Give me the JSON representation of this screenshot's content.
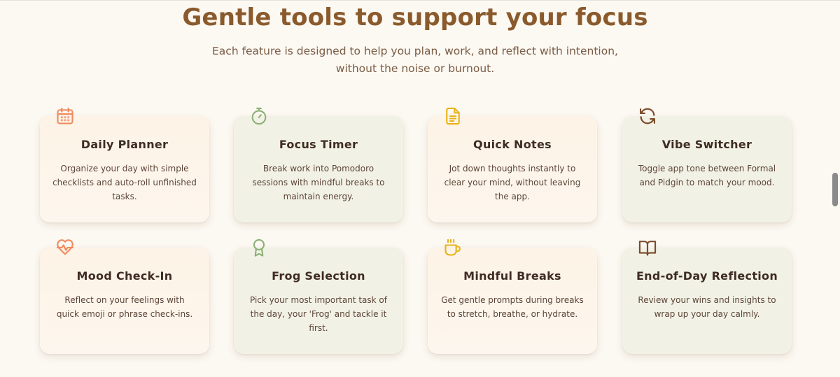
{
  "section": {
    "title": "Gentle tools to support your focus",
    "subtitle_line1": "Each feature is designed to help you plan, work, and reflect with intention,",
    "subtitle_line2": "without the noise or burnout."
  },
  "features": [
    {
      "title": "Daily Planner",
      "description": "Organize your day with simple checklists and auto-roll unfinished tasks.",
      "icon": "calendar-icon",
      "icon_color": "#f08a5d"
    },
    {
      "title": "Focus Timer",
      "description": "Break work into Pomodoro sessions with mindful breaks to maintain energy.",
      "icon": "stopwatch-icon",
      "icon_color": "#8bb174"
    },
    {
      "title": "Quick Notes",
      "description": "Jot down thoughts instantly to clear your mind, without leaving the app.",
      "icon": "note-icon",
      "icon_color": "#e8b417"
    },
    {
      "title": "Vibe Switcher",
      "description": "Toggle app tone between Formal and Pidgin to match your mood.",
      "icon": "refresh-icon",
      "icon_color": "#7a4a2a"
    },
    {
      "title": "Mood Check-In",
      "description": "Reflect on your feelings with quick emoji or phrase check-ins.",
      "icon": "heart-pulse-icon",
      "icon_color": "#f08a5d"
    },
    {
      "title": "Frog Selection",
      "description": "Pick your most important task of the day, your 'Frog' and tackle it first.",
      "icon": "award-icon",
      "icon_color": "#8bb174"
    },
    {
      "title": "Mindful Breaks",
      "description": "Get gentle prompts during breaks to stretch, breathe, or hydrate.",
      "icon": "coffee-icon",
      "icon_color": "#e8b417"
    },
    {
      "title": "End-of-Day Reflection",
      "description": "Review your wins and insights to wrap up your day calmly.",
      "icon": "book-icon",
      "icon_color": "#7a4a2a"
    }
  ]
}
